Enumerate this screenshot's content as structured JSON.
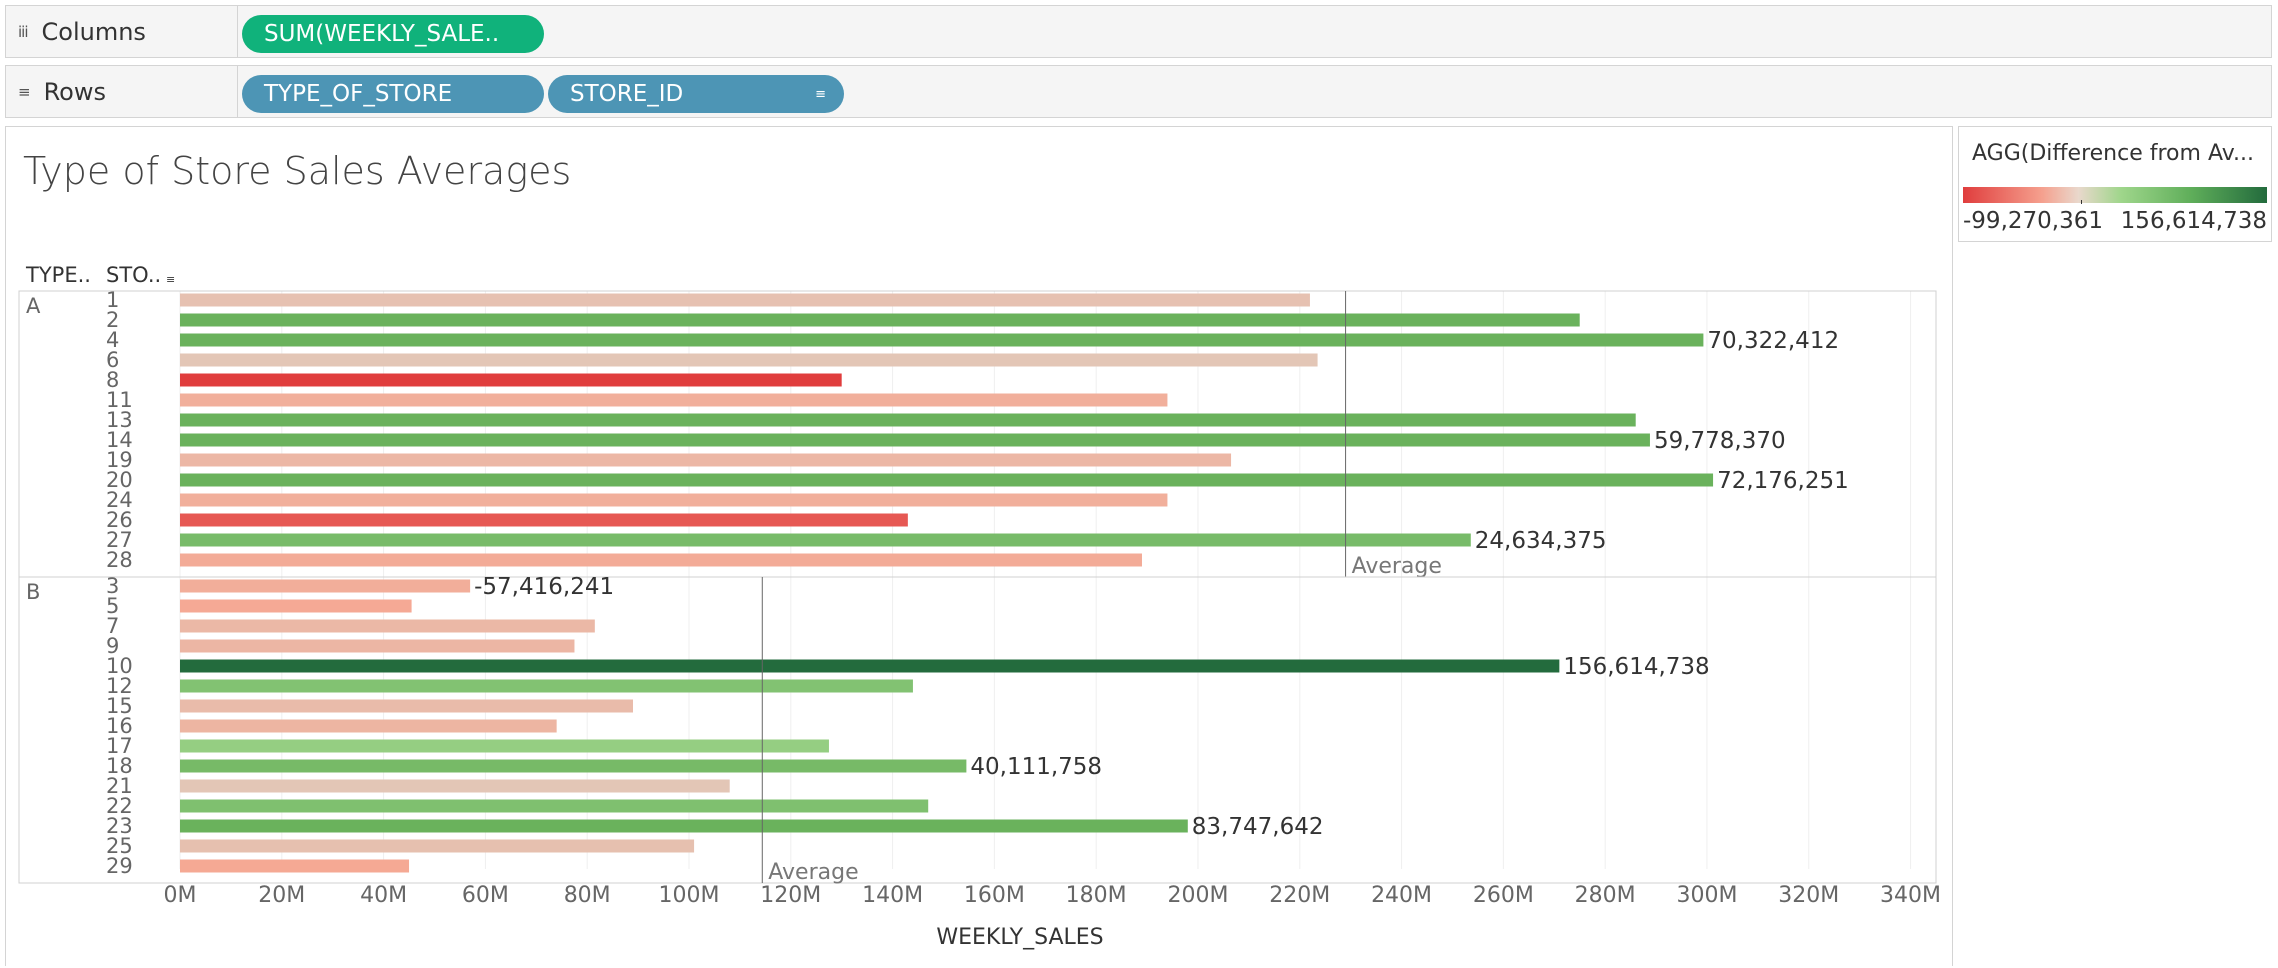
{
  "shelves": {
    "columns": {
      "label": "Columns",
      "icon": "columns-icon",
      "pills": [
        "SUM(WEEKLY_SALE.."
      ]
    },
    "rows": {
      "label": "Rows",
      "icon": "rows-icon",
      "pills": [
        "TYPE_OF_STORE",
        "STORE_ID"
      ]
    }
  },
  "legend": {
    "title": "AGG(Difference from Av...",
    "min_label": "-99,270,361",
    "max_label": "156,614,738"
  },
  "chart_data": {
    "type": "bar",
    "title": "Type of Store Sales Averages",
    "xlabel": "WEEKLY_SALES",
    "row_headers": [
      "TYPE..",
      "STO.."
    ],
    "xlim": [
      0,
      345000000
    ],
    "x_ticks": [
      0,
      20000000,
      40000000,
      60000000,
      80000000,
      100000000,
      120000000,
      140000000,
      160000000,
      180000000,
      200000000,
      220000000,
      240000000,
      260000000,
      280000000,
      300000000,
      320000000,
      340000000
    ],
    "x_tick_labels": [
      "0M",
      "20M",
      "40M",
      "60M",
      "80M",
      "100M",
      "120M",
      "140M",
      "160M",
      "180M",
      "200M",
      "220M",
      "240M",
      "260M",
      "280M",
      "300M",
      "320M",
      "340M"
    ],
    "reference_line_label": "Average",
    "colors": {
      "neg_strong": "#e03d3d",
      "neg_light": "#f7a590",
      "neutral": "#e3c6b6",
      "pos_light": "#a3d78f",
      "pos": "#6ab25c",
      "pos_strong": "#236b3d"
    },
    "groups": [
      {
        "name": "A",
        "average": 229000000,
        "stores": [
          {
            "id": "1",
            "value": 222000000
          },
          {
            "id": "2",
            "value": 275000000
          },
          {
            "id": "4",
            "value": 299300000,
            "label": "70,322,412"
          },
          {
            "id": "6",
            "value": 223500000
          },
          {
            "id": "8",
            "value": 130000000
          },
          {
            "id": "11",
            "value": 194000000
          },
          {
            "id": "13",
            "value": 286000000
          },
          {
            "id": "14",
            "value": 288800000,
            "label": "59,778,370"
          },
          {
            "id": "19",
            "value": 206500000
          },
          {
            "id": "20",
            "value": 301200000,
            "label": "72,176,251"
          },
          {
            "id": "24",
            "value": 194000000
          },
          {
            "id": "26",
            "value": 143000000
          },
          {
            "id": "27",
            "value": 253600000,
            "label": "24,634,375"
          },
          {
            "id": "28",
            "value": 189000000
          }
        ]
      },
      {
        "name": "B",
        "average": 114400000,
        "stores": [
          {
            "id": "3",
            "value": 57000000,
            "label": "-57,416,241"
          },
          {
            "id": "5",
            "value": 45500000
          },
          {
            "id": "7",
            "value": 81500000
          },
          {
            "id": "9",
            "value": 77500000
          },
          {
            "id": "10",
            "value": 271000000,
            "label": "156,614,738"
          },
          {
            "id": "12",
            "value": 144000000
          },
          {
            "id": "15",
            "value": 89000000
          },
          {
            "id": "16",
            "value": 74000000
          },
          {
            "id": "17",
            "value": 127500000
          },
          {
            "id": "18",
            "value": 154500000,
            "label": "40,111,758"
          },
          {
            "id": "21",
            "value": 108000000
          },
          {
            "id": "22",
            "value": 147000000
          },
          {
            "id": "23",
            "value": 198000000,
            "label": "83,747,642"
          },
          {
            "id": "25",
            "value": 101000000
          },
          {
            "id": "29",
            "value": 45000000
          }
        ]
      }
    ]
  }
}
